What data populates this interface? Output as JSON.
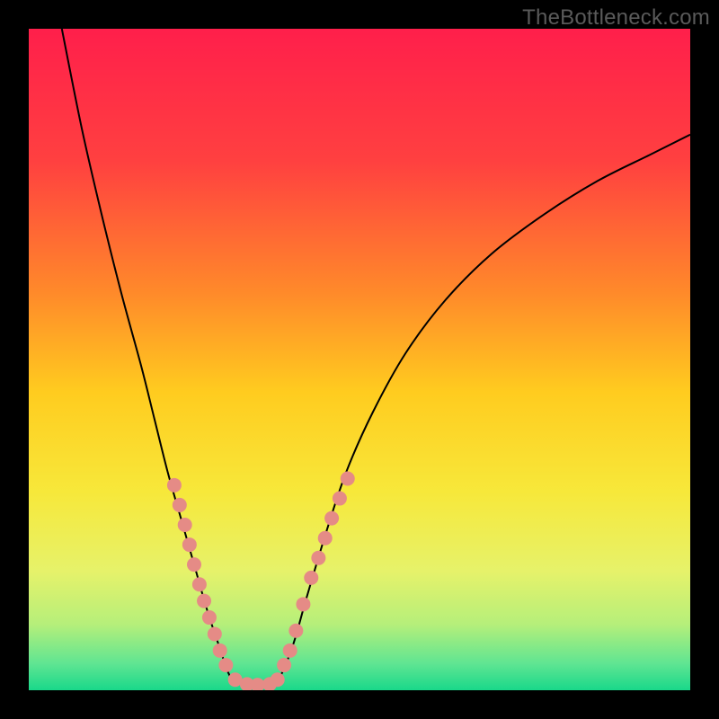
{
  "watermark": "TheBottleneck.com",
  "chart_data": {
    "type": "line",
    "title": "",
    "xlabel": "",
    "ylabel": "",
    "xlim": [
      0,
      100
    ],
    "ylim": [
      0,
      100
    ],
    "grid": false,
    "legend": false,
    "background": {
      "style": "vertical-gradient",
      "stops": [
        {
          "pos": 0.0,
          "color": "#ff1f4b"
        },
        {
          "pos": 0.2,
          "color": "#ff4040"
        },
        {
          "pos": 0.4,
          "color": "#ff8a2a"
        },
        {
          "pos": 0.55,
          "color": "#ffcc1f"
        },
        {
          "pos": 0.7,
          "color": "#f7e83a"
        },
        {
          "pos": 0.82,
          "color": "#e6f26a"
        },
        {
          "pos": 0.9,
          "color": "#b6ef7a"
        },
        {
          "pos": 0.96,
          "color": "#5fe592"
        },
        {
          "pos": 1.0,
          "color": "#19d88a"
        }
      ]
    },
    "series": [
      {
        "name": "left-curve",
        "stroke": "#000000",
        "stroke_width": 2,
        "points": [
          {
            "x": 5,
            "y": 100
          },
          {
            "x": 8,
            "y": 85
          },
          {
            "x": 11,
            "y": 72
          },
          {
            "x": 14,
            "y": 60
          },
          {
            "x": 17,
            "y": 49
          },
          {
            "x": 19,
            "y": 41
          },
          {
            "x": 21,
            "y": 33
          },
          {
            "x": 23,
            "y": 26
          },
          {
            "x": 25,
            "y": 19
          },
          {
            "x": 27,
            "y": 12
          },
          {
            "x": 29,
            "y": 6
          },
          {
            "x": 30,
            "y": 3
          },
          {
            "x": 31,
            "y": 1.5
          },
          {
            "x": 33,
            "y": 0.8
          },
          {
            "x": 35,
            "y": 0.7
          }
        ]
      },
      {
        "name": "right-curve",
        "stroke": "#000000",
        "stroke_width": 2,
        "points": [
          {
            "x": 35,
            "y": 0.7
          },
          {
            "x": 37,
            "y": 0.8
          },
          {
            "x": 38,
            "y": 2
          },
          {
            "x": 40,
            "y": 7
          },
          {
            "x": 42,
            "y": 14
          },
          {
            "x": 45,
            "y": 24
          },
          {
            "x": 48,
            "y": 33
          },
          {
            "x": 52,
            "y": 42
          },
          {
            "x": 57,
            "y": 51
          },
          {
            "x": 63,
            "y": 59
          },
          {
            "x": 70,
            "y": 66
          },
          {
            "x": 78,
            "y": 72
          },
          {
            "x": 86,
            "y": 77
          },
          {
            "x": 94,
            "y": 81
          },
          {
            "x": 100,
            "y": 84
          }
        ]
      }
    ],
    "scatter": {
      "name": "markers",
      "fill": "#e58b86",
      "radius": 8,
      "points": [
        {
          "x": 22.0,
          "y": 31.0
        },
        {
          "x": 22.8,
          "y": 28.0
        },
        {
          "x": 23.6,
          "y": 25.0
        },
        {
          "x": 24.3,
          "y": 22.0
        },
        {
          "x": 25.0,
          "y": 19.0
        },
        {
          "x": 25.8,
          "y": 16.0
        },
        {
          "x": 26.5,
          "y": 13.5
        },
        {
          "x": 27.3,
          "y": 11.0
        },
        {
          "x": 28.1,
          "y": 8.5
        },
        {
          "x": 28.9,
          "y": 6.0
        },
        {
          "x": 29.8,
          "y": 3.8
        },
        {
          "x": 31.2,
          "y": 1.6
        },
        {
          "x": 33.0,
          "y": 0.9
        },
        {
          "x": 34.6,
          "y": 0.8
        },
        {
          "x": 36.4,
          "y": 0.9
        },
        {
          "x": 37.6,
          "y": 1.6
        },
        {
          "x": 38.6,
          "y": 3.8
        },
        {
          "x": 39.5,
          "y": 6.0
        },
        {
          "x": 40.4,
          "y": 9.0
        },
        {
          "x": 41.5,
          "y": 13.0
        },
        {
          "x": 42.7,
          "y": 17.0
        },
        {
          "x": 43.8,
          "y": 20.0
        },
        {
          "x": 44.8,
          "y": 23.0
        },
        {
          "x": 45.8,
          "y": 26.0
        },
        {
          "x": 47.0,
          "y": 29.0
        },
        {
          "x": 48.2,
          "y": 32.0
        }
      ]
    }
  }
}
